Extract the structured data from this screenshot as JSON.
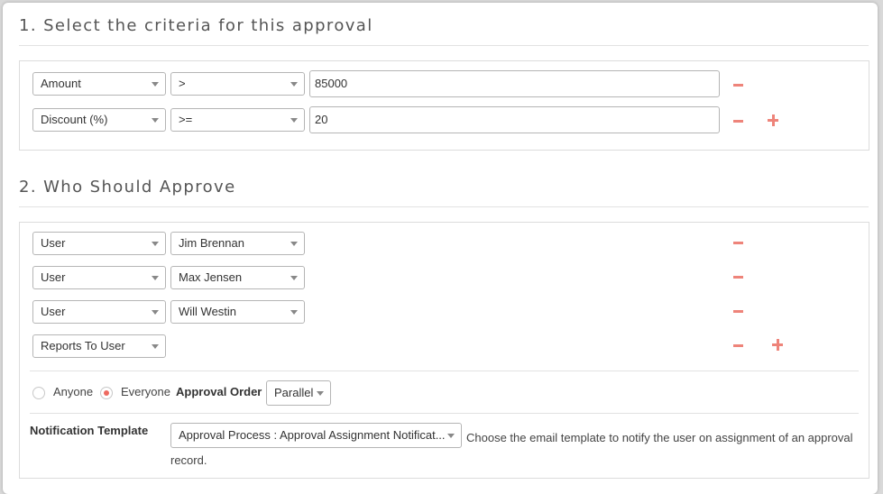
{
  "section1": {
    "title": "1. Select the criteria for this approval",
    "criteria": [
      {
        "field": "Amount",
        "operator": ">",
        "value": "85000"
      },
      {
        "field": "Discount (%)",
        "operator": ">=",
        "value": "20"
      }
    ]
  },
  "section2": {
    "title": "2. Who Should Approve",
    "approvers": [
      {
        "type": "User",
        "name": "Jim Brennan"
      },
      {
        "type": "User",
        "name": "Max Jensen"
      },
      {
        "type": "User",
        "name": "Will Westin"
      },
      {
        "type": "Reports To User",
        "name": null
      }
    ],
    "approval_mode": {
      "options": [
        "Anyone",
        "Everyone"
      ],
      "selected": "Everyone"
    },
    "approval_order_label": "Approval Order",
    "approval_order_value": "Parallel",
    "notification_template_label": "Notification Template",
    "notification_template_value": "Approval Process : Approval Assignment Notificat...",
    "notification_template_help": "Choose the email template to notify the user on assignment of an approval record."
  },
  "icons": {
    "remove": "minus-icon",
    "add": "plus-icon",
    "dropdown": "caret-down-icon"
  },
  "colors": {
    "accent": "#ee847a",
    "radio_checked": "#ee6a60"
  }
}
